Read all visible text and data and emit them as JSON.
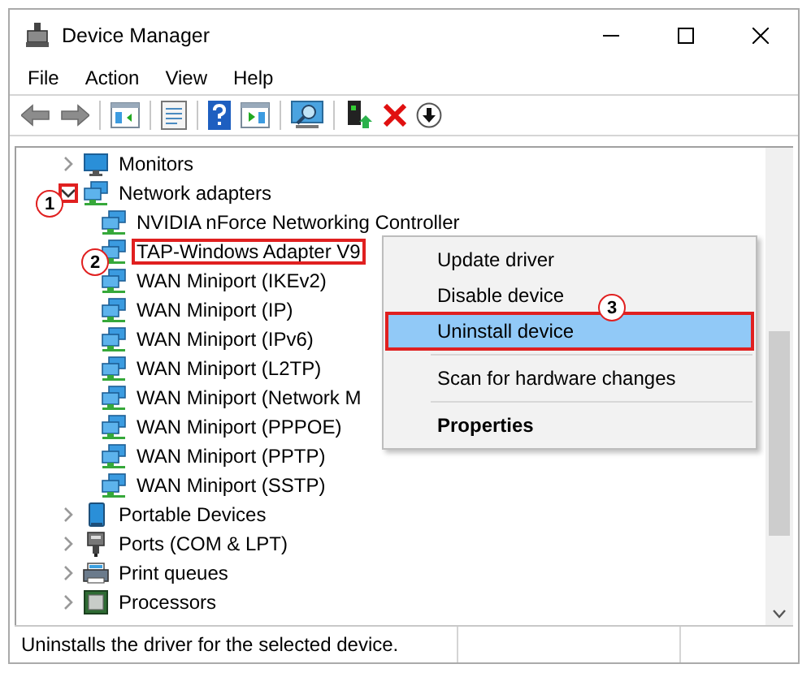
{
  "window": {
    "title": "Device Manager"
  },
  "menu": [
    "File",
    "Action",
    "View",
    "Help"
  ],
  "tree": [
    {
      "label": "Monitors",
      "kind": "monitor",
      "expanded": false
    },
    {
      "label": "Network adapters",
      "kind": "network",
      "expanded": true,
      "callout": {
        "number": "1",
        "kind": "expander"
      },
      "children": [
        {
          "label": "NVIDIA nForce Networking Controller",
          "kind": "network"
        },
        {
          "label": "TAP-Windows Adapter V9",
          "kind": "network",
          "callout": {
            "number": "2",
            "kind": "label"
          }
        },
        {
          "label": "WAN Miniport (IKEv2)",
          "kind": "network"
        },
        {
          "label": "WAN Miniport (IP)",
          "kind": "network"
        },
        {
          "label": "WAN Miniport (IPv6)",
          "kind": "network"
        },
        {
          "label": "WAN Miniport (L2TP)",
          "kind": "network"
        },
        {
          "label": "WAN Miniport (Network M",
          "kind": "network"
        },
        {
          "label": "WAN Miniport (PPPOE)",
          "kind": "network"
        },
        {
          "label": "WAN Miniport (PPTP)",
          "kind": "network"
        },
        {
          "label": "WAN Miniport (SSTP)",
          "kind": "network"
        }
      ]
    },
    {
      "label": "Portable Devices",
      "kind": "portable",
      "expanded": false
    },
    {
      "label": "Ports (COM & LPT)",
      "kind": "port",
      "expanded": false
    },
    {
      "label": "Print queues",
      "kind": "printer",
      "expanded": false
    },
    {
      "label": "Processors",
      "kind": "processor",
      "expanded": false
    }
  ],
  "context_menu": [
    {
      "kind": "item",
      "label": "Update driver",
      "highlighted": false
    },
    {
      "kind": "item",
      "label": "Disable device",
      "highlighted": false
    },
    {
      "kind": "item",
      "label": "Uninstall device",
      "highlighted": true,
      "callout": {
        "number": "3",
        "kind": "item"
      }
    },
    {
      "kind": "separator"
    },
    {
      "kind": "item",
      "label": "Scan for hardware changes",
      "highlighted": false
    },
    {
      "kind": "separator"
    },
    {
      "kind": "item",
      "label": "Properties",
      "highlighted": false,
      "default": true
    }
  ],
  "status_bar": {
    "text": "Uninstalls the driver for the selected device."
  }
}
